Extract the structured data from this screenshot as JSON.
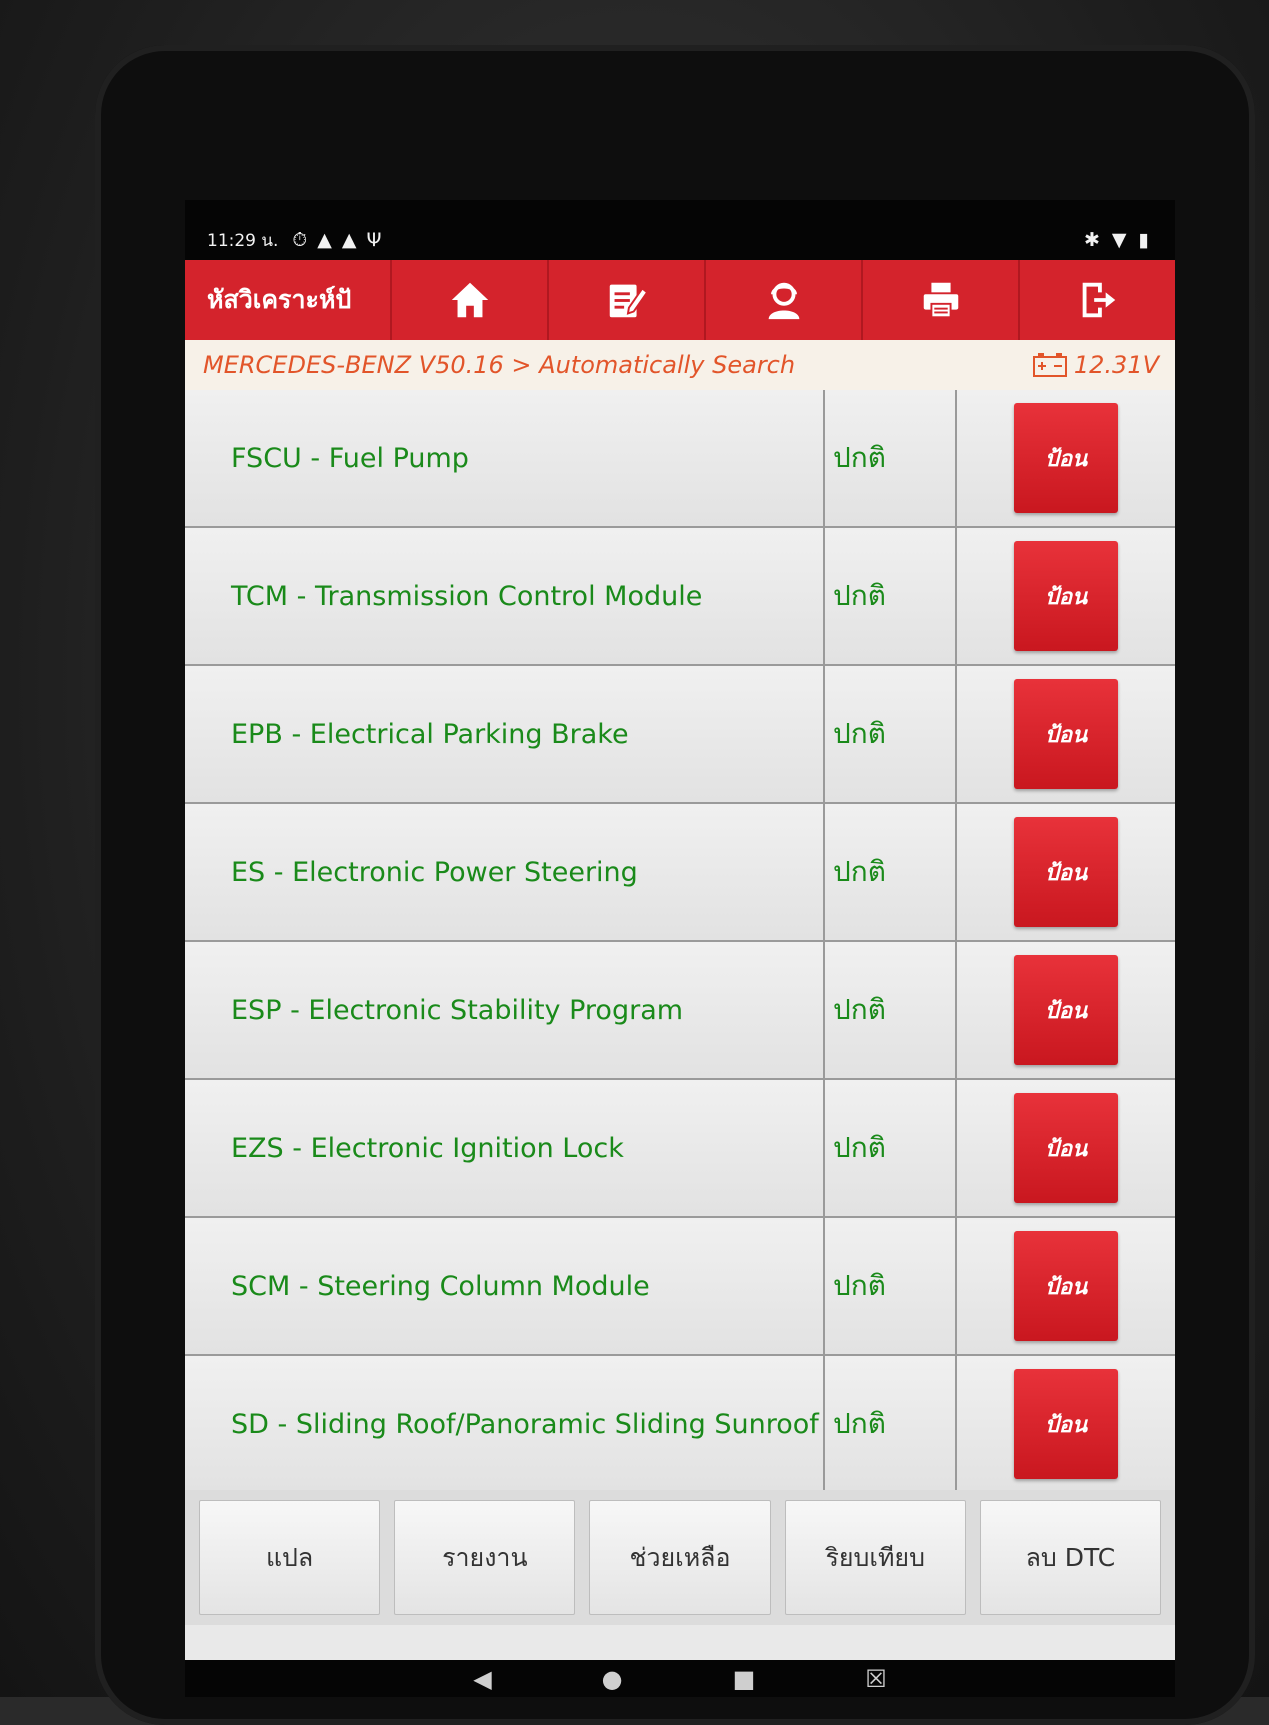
{
  "status_bar": {
    "time": "11:29 น.",
    "icons_left": [
      "alarm-icon",
      "warning-icon",
      "warning-icon",
      "usb-icon"
    ],
    "icons_right": [
      "bluetooth-icon",
      "wifi-icon",
      "battery-icon"
    ]
  },
  "toolbar": {
    "title": "หัสวิเคราะห์ปั",
    "buttons": [
      "home-icon",
      "edit-report-icon",
      "support-icon",
      "print-icon",
      "exit-icon"
    ]
  },
  "breadcrumb": {
    "path": "MERCEDES-BENZ V50.16 > Automatically Search",
    "voltage": "12.31V"
  },
  "modules": [
    {
      "name": "FSCU - Fuel Pump",
      "status": "ปกติ",
      "action": "ป้อน"
    },
    {
      "name": "TCM - Transmission Control Module",
      "status": "ปกติ",
      "action": "ป้อน"
    },
    {
      "name": "EPB - Electrical Parking Brake",
      "status": "ปกติ",
      "action": "ป้อน"
    },
    {
      "name": "ES - Electronic Power Steering",
      "status": "ปกติ",
      "action": "ป้อน"
    },
    {
      "name": "ESP - Electronic Stability Program",
      "status": "ปกติ",
      "action": "ป้อน"
    },
    {
      "name": "EZS - Electronic Ignition Lock",
      "status": "ปกติ",
      "action": "ป้อน"
    },
    {
      "name": "SCM - Steering Column Module",
      "status": "ปกติ",
      "action": "ป้อน"
    },
    {
      "name": "SD - Sliding Roof/Panoramic Sliding Sunroof",
      "status": "ปกติ",
      "action": "ป้อน"
    }
  ],
  "bottom_buttons": {
    "translate": "แปล",
    "report": "รายงาน",
    "help": "ช่วยเหลือ",
    "compare": "ริยบเทียบ",
    "clear_dtc": "ลบ DTC"
  },
  "colors": {
    "brand_red": "#d4232c",
    "status_green": "#1a8a1a",
    "breadcrumb_orange": "#e2552a"
  }
}
